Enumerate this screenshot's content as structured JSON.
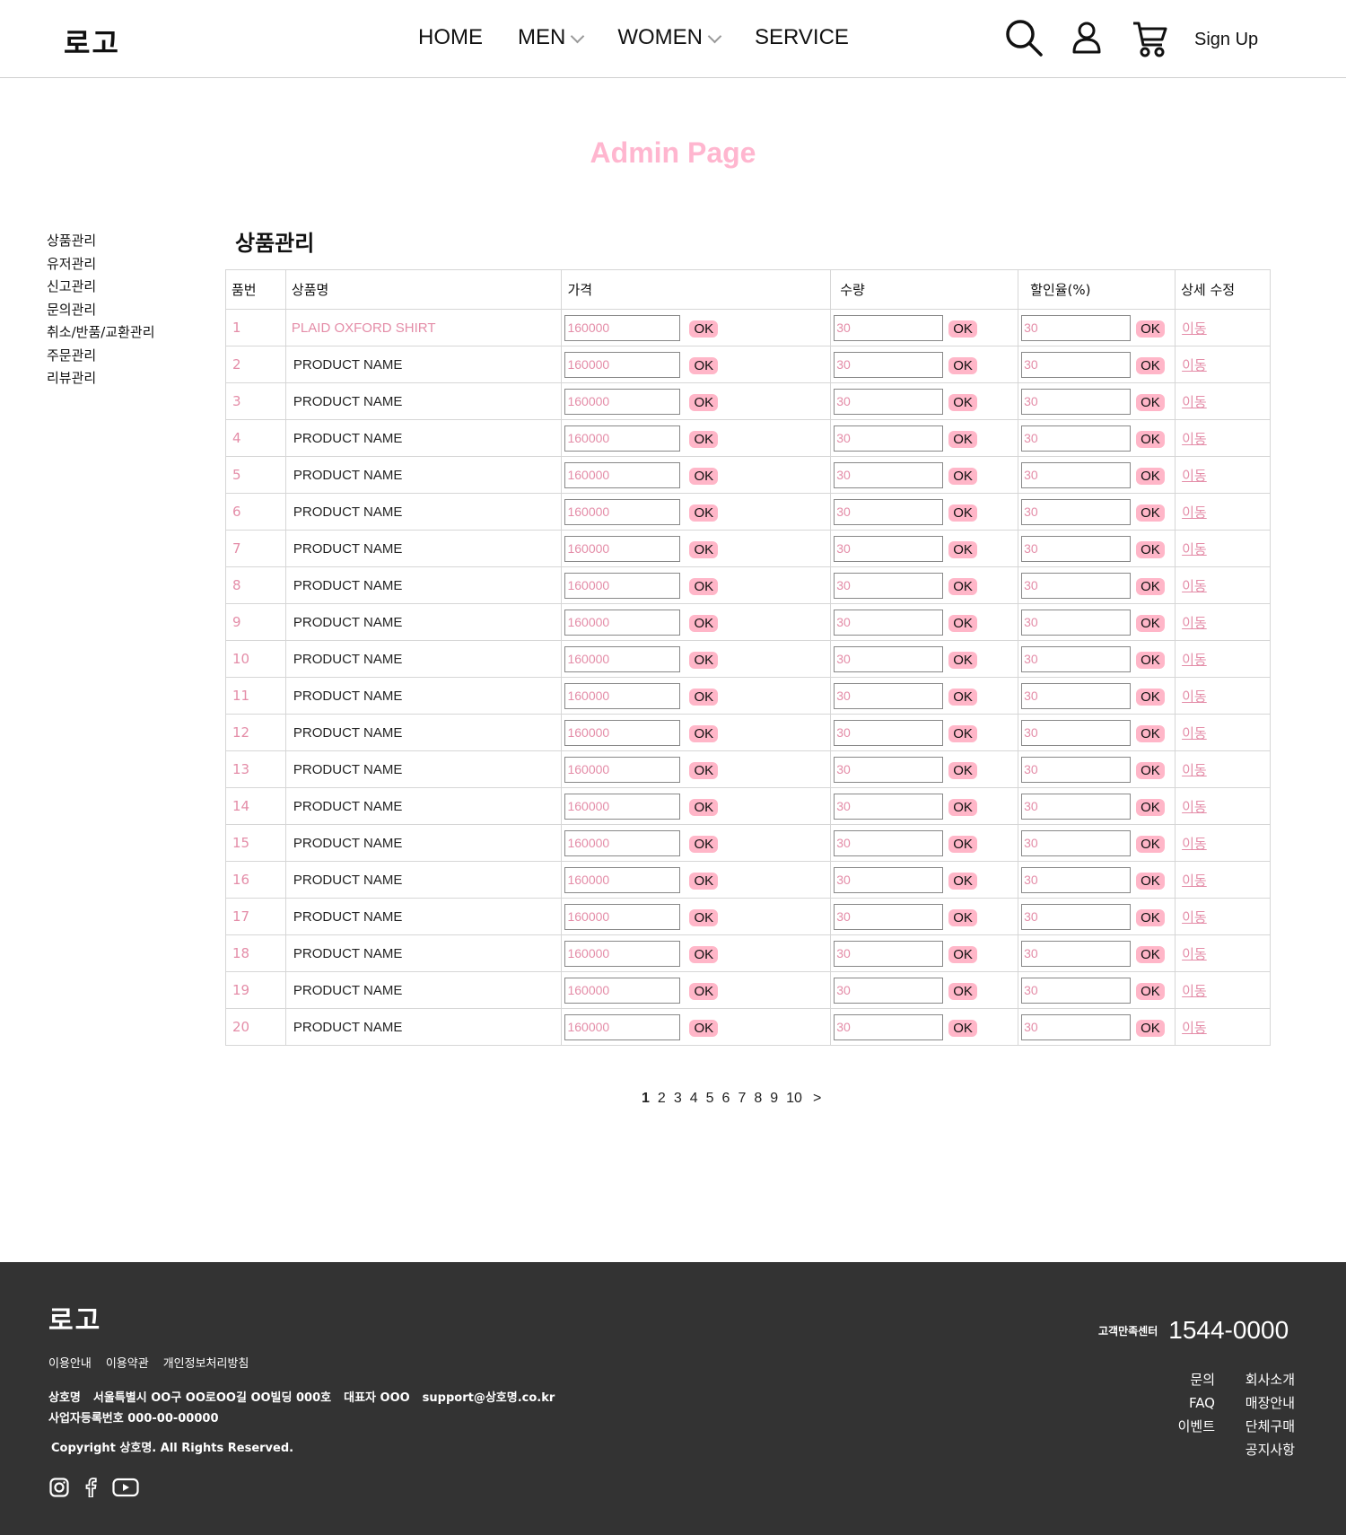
{
  "header": {
    "logo": "로고",
    "nav": [
      "HOME",
      "MEN",
      "WOMEN",
      "SERVICE"
    ],
    "icons": [
      "search-icon",
      "user-icon",
      "cart-icon"
    ],
    "signup": "Sign Up"
  },
  "page_title": "Admin Page",
  "sidebar": {
    "items": [
      "상품관리",
      "유저관리",
      "신고관리",
      "문의관리",
      "취소/반품/교환관리",
      "주문관리",
      "리뷰관리"
    ]
  },
  "section_title": "상품관리",
  "table": {
    "headers": [
      "품번",
      "상품명",
      "가격",
      "수량",
      "할인율(%)",
      "상세 수정"
    ],
    "ok_label": "OK",
    "move_label": "이동",
    "rows": [
      {
        "no": "1",
        "name": "PLAID OXFORD SHIRT",
        "price": "160000",
        "qty": "30",
        "discount": "30"
      },
      {
        "no": "2",
        "name": "PRODUCT NAME",
        "price": "160000",
        "qty": "30",
        "discount": "30"
      },
      {
        "no": "3",
        "name": "PRODUCT NAME",
        "price": "160000",
        "qty": "30",
        "discount": "30"
      },
      {
        "no": "4",
        "name": "PRODUCT NAME",
        "price": "160000",
        "qty": "30",
        "discount": "30"
      },
      {
        "no": "5",
        "name": "PRODUCT NAME",
        "price": "160000",
        "qty": "30",
        "discount": "30"
      },
      {
        "no": "6",
        "name": "PRODUCT NAME",
        "price": "160000",
        "qty": "30",
        "discount": "30"
      },
      {
        "no": "7",
        "name": "PRODUCT NAME",
        "price": "160000",
        "qty": "30",
        "discount": "30"
      },
      {
        "no": "8",
        "name": "PRODUCT NAME",
        "price": "160000",
        "qty": "30",
        "discount": "30"
      },
      {
        "no": "9",
        "name": "PRODUCT NAME",
        "price": "160000",
        "qty": "30",
        "discount": "30"
      },
      {
        "no": "10",
        "name": "PRODUCT NAME",
        "price": "160000",
        "qty": "30",
        "discount": "30"
      },
      {
        "no": "11",
        "name": "PRODUCT NAME",
        "price": "160000",
        "qty": "30",
        "discount": "30"
      },
      {
        "no": "12",
        "name": "PRODUCT NAME",
        "price": "160000",
        "qty": "30",
        "discount": "30"
      },
      {
        "no": "13",
        "name": "PRODUCT NAME",
        "price": "160000",
        "qty": "30",
        "discount": "30"
      },
      {
        "no": "14",
        "name": "PRODUCT NAME",
        "price": "160000",
        "qty": "30",
        "discount": "30"
      },
      {
        "no": "15",
        "name": "PRODUCT NAME",
        "price": "160000",
        "qty": "30",
        "discount": "30"
      },
      {
        "no": "16",
        "name": "PRODUCT NAME",
        "price": "160000",
        "qty": "30",
        "discount": "30"
      },
      {
        "no": "17",
        "name": "PRODUCT NAME",
        "price": "160000",
        "qty": "30",
        "discount": "30"
      },
      {
        "no": "18",
        "name": "PRODUCT NAME",
        "price": "160000",
        "qty": "30",
        "discount": "30"
      },
      {
        "no": "19",
        "name": "PRODUCT NAME",
        "price": "160000",
        "qty": "30",
        "discount": "30"
      },
      {
        "no": "20",
        "name": "PRODUCT NAME",
        "price": "160000",
        "qty": "30",
        "discount": "30"
      }
    ]
  },
  "pagination": {
    "pages": [
      "1",
      "2",
      "3",
      "4",
      "5",
      "6",
      "7",
      "8",
      "9",
      "10"
    ],
    "current": "1",
    "next": ">"
  },
  "footer": {
    "logo": "로고",
    "links": [
      "이용안내",
      "이용약관",
      "개인정보처리방침"
    ],
    "info_line1": [
      "상호명",
      "서울특별시 OO구 OO로OO길 OO빌딩 000호",
      "대표자 OOO",
      "support@상호명.co.kr"
    ],
    "info_line2": "사업자등록번호 000-00-00000",
    "copyright": "Copyright 상호명. All Rights Reserved.",
    "social": [
      "instagram-icon",
      "facebook-icon",
      "youtube-icon"
    ],
    "cs_label": "고객만족센터",
    "cs_phone": "1544-0000",
    "menu_left": [
      "문의",
      "FAQ",
      "이벤트"
    ],
    "menu_right": [
      "회사소개",
      "매장안내",
      "단체구매",
      "공지사항"
    ]
  },
  "colors": {
    "accent_pink": "#ffb6cf",
    "text_pink": "#e48da8",
    "footer_bg": "#333333"
  }
}
